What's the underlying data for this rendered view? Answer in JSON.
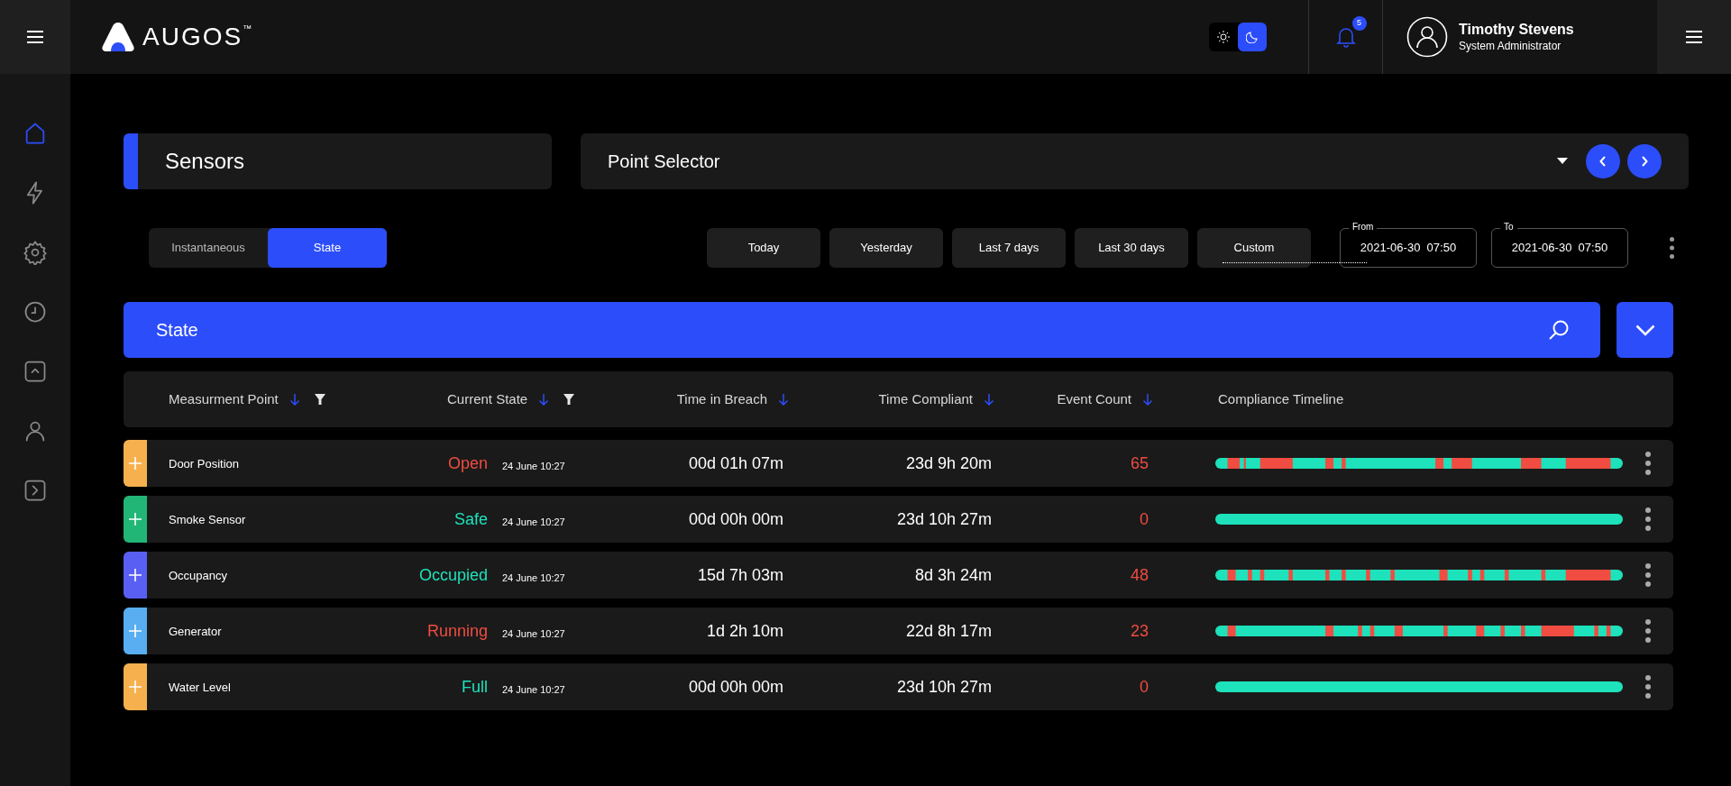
{
  "header": {
    "logo": "AUGOS",
    "logo_mark": "™",
    "theme": {
      "dark_selected": true
    },
    "notifications": {
      "count": "5"
    },
    "user": {
      "name": "Timothy Stevens",
      "role": "System Administrator"
    }
  },
  "sidebar": {
    "items": [
      {
        "selected": true
      },
      {
        "selected": false
      },
      {
        "selected": false
      },
      {
        "selected": false
      },
      {
        "selected": false
      },
      {
        "selected": false
      },
      {
        "selected": false
      }
    ]
  },
  "title": "Sensors",
  "point_selector": {
    "label": "Point Selector"
  },
  "mode_tabs": [
    {
      "label": "Instantaneous",
      "selected": false
    },
    {
      "label": "State",
      "selected": true
    }
  ],
  "range_buttons": [
    "Today",
    "Yesterday",
    "Last 7 days",
    "Last 30 days",
    "Custom"
  ],
  "from": {
    "label": "From",
    "value": "2021-06-30  07:50"
  },
  "to": {
    "label": "To",
    "value": "2021-06-30  07:50"
  },
  "section_title": "State",
  "table": {
    "columns": [
      {
        "label": "Measurment Point",
        "filter": true
      },
      {
        "label": "Current State",
        "filter": true
      },
      {
        "label": "Time in Breach",
        "filter": false
      },
      {
        "label": "Time Compliant",
        "filter": false
      },
      {
        "label": "Event Count",
        "filter": false
      },
      {
        "label": "Compliance Timeline"
      }
    ],
    "rows": [
      {
        "name": "Door Position",
        "color": "#f6b04e",
        "state": "Open",
        "state_alert": true,
        "date": "24 June 10:27",
        "breach": "00d 01h 07m",
        "compliant": "23d 9h 20m",
        "events": "65"
      },
      {
        "name": "Smoke Sensor",
        "color": "#22b676",
        "state": "Safe",
        "state_alert": false,
        "date": "24 June 10:27",
        "breach": "00d 00h 00m",
        "compliant": "23d 10h 27m",
        "events": "0"
      },
      {
        "name": "Occupancy",
        "color": "#5a5ff3",
        "state": "Occupied",
        "state_alert": false,
        "date": "24 June 10:27",
        "breach": "15d 7h 03m",
        "compliant": "8d 3h 24m",
        "events": "48"
      },
      {
        "name": "Generator",
        "color": "#58aef1",
        "state": "Running",
        "state_alert": true,
        "date": "24 June 10:27",
        "breach": "1d 2h 10m",
        "compliant": "22d 8h 17m",
        "events": "23"
      },
      {
        "name": "Water Level",
        "color": "#f6b04e",
        "state": "Full",
        "state_alert": false,
        "date": "24 June 10:27",
        "breach": "00d 00h 00m",
        "compliant": "23d 10h 27m",
        "events": "0"
      }
    ]
  }
}
